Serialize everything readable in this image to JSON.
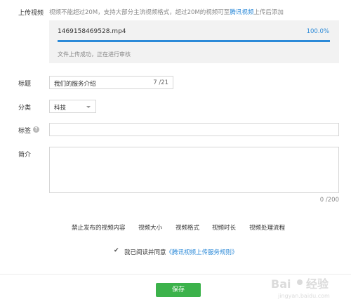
{
  "upload": {
    "label": "上传视频",
    "hint_prefix": "视频不能超过20M，支持大部分主流视频格式，超过20M的视频可至",
    "hint_link": "腾讯视频",
    "hint_suffix": "上传后添加",
    "file_name": "1469158469528.mp4",
    "progress_text": "100.0%",
    "progress": 1.0,
    "status": "文件上传成功，正在进行审核"
  },
  "title": {
    "label": "标题",
    "value": "我们的服务介绍",
    "count": "7 /21"
  },
  "category": {
    "label": "分类",
    "value": "科技"
  },
  "tags": {
    "label": "标签",
    "value": ""
  },
  "intro": {
    "label": "简介",
    "value": "",
    "count": "0 /200"
  },
  "links": [
    "禁止发布的视频内容",
    "视频大小",
    "视频格式",
    "视频时长",
    "视频处理流程"
  ],
  "agreement": {
    "checked": true,
    "check_glyph": "✔",
    "text": "我已阅读并同意",
    "link": "《腾讯视频上传服务规则》"
  },
  "save_label": "保存",
  "watermark": {
    "logo": "Baidu 经验",
    "url": "jingyan.baidu.com"
  },
  "colors": {
    "accent": "#2c8ad8",
    "save": "#3cb24b",
    "upload_bg": "#f2f2f2"
  }
}
